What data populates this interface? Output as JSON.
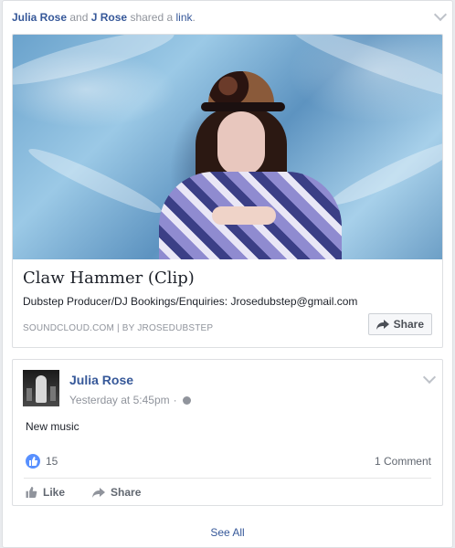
{
  "header": {
    "user1": "Julia Rose",
    "and": "and",
    "user2": "J Rose",
    "shared": "shared a",
    "link_word": "link",
    "period": "."
  },
  "link_card": {
    "title": "Claw Hammer (Clip)",
    "description": "Dubstep Producer/DJ Bookings/Enquiries: Jrosedubstep@gmail.com",
    "source": "SOUNDCLOUD.COM | BY JROSEDUBSTEP",
    "share_label": "Share"
  },
  "post": {
    "author": "Julia Rose",
    "timestamp": "Yesterday at 5:45pm",
    "separator": "·",
    "text": "New music",
    "like_count": "15",
    "comment_count": "1 Comment",
    "like_label": "Like",
    "share_label": "Share"
  },
  "footer": {
    "see_all": "See All"
  },
  "colors": {
    "link_blue": "#365899",
    "like_badge": "#5890ff",
    "meta_gray": "#90949c"
  },
  "icons": [
    "chevron-down-icon",
    "share-arrow-icon",
    "thumbs-up-icon",
    "globe-icon"
  ]
}
